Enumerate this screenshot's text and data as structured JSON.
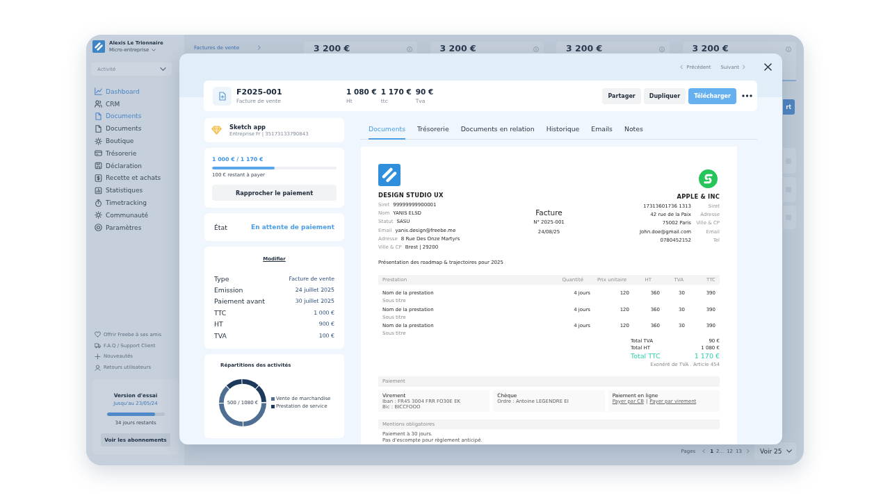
{
  "sidebar": {
    "account": {
      "name": "Alexis Le Trionnaire",
      "plan": "Micro-entreprise"
    },
    "activity_select": {
      "placeholder": "Activité"
    },
    "nav_items": [
      {
        "label": "Dashboard",
        "selected": true
      },
      {
        "label": "CRM",
        "selected": false
      },
      {
        "label": "Documents",
        "selected": true
      },
      {
        "label": "Documents",
        "selected": false
      },
      {
        "label": "Boutique",
        "selected": false
      },
      {
        "label": "Trésorerie",
        "selected": false
      },
      {
        "label": "Déclaration",
        "selected": false
      },
      {
        "label": "Recette et achats",
        "selected": false
      },
      {
        "label": "Statistiques",
        "selected": false
      },
      {
        "label": "Timetracking",
        "selected": false
      },
      {
        "label": "Communauté",
        "selected": false
      },
      {
        "label": "Paramètres",
        "selected": false
      }
    ],
    "footer_links": [
      "Offrir Freebe à ses amis",
      "F.A.Q / Support Client",
      "Nouveautés",
      "Retours utilisateurs"
    ],
    "trial": {
      "title": "Version d'essai",
      "until": "Jusqu'au 23/05/24",
      "level": 0.84,
      "remaining": "34 jours restants",
      "button": "Voir les abonnements"
    }
  },
  "page": {
    "breadcrumb": "Factures de vente",
    "stat_cards": [
      "3 200 €",
      "3 200 €",
      "3 200 €",
      "3 200 €"
    ],
    "export_button": "rt",
    "pagination": {
      "label": "Pages",
      "pages": [
        {
          "label": "1",
          "selected": true
        },
        {
          "label": "2...",
          "selected": false
        },
        {
          "label": "12",
          "selected": false
        },
        {
          "label": "13",
          "selected": false
        }
      ],
      "page_size": "Voir 25"
    }
  },
  "modal": {
    "previous": "Précédent",
    "next": "Suivant",
    "invoice": {
      "number": "F2025-001",
      "type": "Facture de vente",
      "amounts": [
        {
          "value": "1 080 €",
          "label": "Ht"
        },
        {
          "value": "1 170 €",
          "label": "ttc"
        },
        {
          "value": "90 €",
          "label": "Tva"
        }
      ],
      "actions": [
        {
          "label": "Partager",
          "primary": false
        },
        {
          "label": "Dupliquer",
          "primary": false
        },
        {
          "label": "Télécharger",
          "primary": true
        }
      ]
    },
    "client": {
      "name": "Sketch app",
      "details": "Entreprise Fr | 35173133790843"
    },
    "payment": {
      "progress": "1 000 € / 1 170 €",
      "level": 0.5,
      "remaining": "100 € restant à payer",
      "button": "Rapprocher le paiement"
    },
    "status": {
      "label": "État",
      "value": "En attente de paiement"
    },
    "details": {
      "edit_link": "Modifier",
      "rows": [
        {
          "label": "Type",
          "value": "Facture de vente"
        },
        {
          "label": "Emission",
          "value": "24 juillet 2025"
        },
        {
          "label": "Paiement avant",
          "value": "30 juillet 2025"
        },
        {
          "label": "TTC",
          "value": "1 000 €"
        },
        {
          "label": "HT",
          "value": "900 €"
        },
        {
          "label": "TVA",
          "value": "100 €"
        }
      ]
    },
    "activity_chart": {
      "title": "Répartitions des activités",
      "center_label": "500 / 1080 €",
      "legend": [
        {
          "label": "Vente de marchandise",
          "color": "#4e6e92"
        },
        {
          "label": "Prestation de service",
          "color": "#1d3a5c"
        }
      ]
    },
    "tabs": [
      {
        "label": "Documents",
        "selected": true
      },
      {
        "label": "Trésorerie",
        "selected": false
      },
      {
        "label": "Documents en relation",
        "selected": false
      },
      {
        "label": "Historique",
        "selected": false
      },
      {
        "label": "Emails",
        "selected": false
      },
      {
        "label": "Notes",
        "selected": false
      }
    ],
    "document": {
      "issuer": {
        "name": "DESIGN STUDIO UX",
        "fields": [
          {
            "label": "Siret",
            "value": "99999999900001"
          },
          {
            "label": "Nom",
            "value": "YANIS ELSD"
          },
          {
            "label": "Statut",
            "value": "SASU"
          },
          {
            "label": "Email",
            "value": "yanis.design@freebe.me"
          },
          {
            "label": "Adresse",
            "value": "8 Rue Des Onze Martyrs"
          },
          {
            "label": "Ville & CP",
            "value": "Brest | 29200"
          }
        ]
      },
      "title": "Facture",
      "number": "N° 2025-001",
      "date": "24/08/25",
      "client": {
        "name": "APPLE & INC",
        "fields": [
          {
            "value": "17313601736 1313",
            "label": "Siret"
          },
          {
            "value": "42 rue de la Paix",
            "label": "Adresse"
          },
          {
            "value": "75002 Paris",
            "label": "Ville & CP"
          },
          {
            "value": "John.doe@gmail.com",
            "label": "Email"
          },
          {
            "value": "0780452152",
            "label": "Tel"
          }
        ]
      },
      "subject": "Présentation des roadmap & trajectoires pour 2025",
      "table": {
        "columns": [
          "Prestation",
          "Quantité",
          "Prix unitaire",
          "HT",
          "TVA",
          "TTC"
        ],
        "rows": [
          {
            "cells": [
              "Nom de la prestation",
              "4 jours",
              "120",
              "360",
              "30",
              "390"
            ],
            "subtitle": "Sous titre"
          },
          {
            "cells": [
              "Nom de la prestation",
              "4 jours",
              "120",
              "360",
              "30",
              "390"
            ],
            "subtitle": "Sous titre"
          },
          {
            "cells": [
              "Nom de la prestation",
              "4 jours",
              "120",
              "360",
              "30",
              "390"
            ],
            "subtitle": "Sous titre"
          }
        ]
      },
      "totals": [
        {
          "label": "Total TVA",
          "value": "90 €",
          "kind": "subtotal"
        },
        {
          "label": "Total HT",
          "value": "1 080 €",
          "kind": "subtotal"
        },
        {
          "label": "Total TTC",
          "value": "1 170 €",
          "kind": "total"
        }
      ],
      "tax_note": "Exonéré de TVA . Article 454",
      "payment_section": {
        "title": "Paiement",
        "methods": [
          {
            "kind": "details",
            "title": "Virement",
            "lines": [
              "Iban : FR45 3004 FRR FO30E EK",
              "Bic : BICCFOOO"
            ]
          },
          {
            "kind": "details",
            "title": "Chèque",
            "lines": [
              "Ordre : Antoine LEGENDRE EI"
            ]
          },
          {
            "kind": "links",
            "title": "Paiement en ligne",
            "links": [
              "Payer par CB",
              "Payer par virement"
            ],
            "separator": "|"
          }
        ]
      },
      "mentions": {
        "title": "Mentions obligatoires",
        "lines": [
          "Paiement à 30 jours.",
          "Pas d'escompte pour règlement anticipé."
        ]
      }
    }
  }
}
